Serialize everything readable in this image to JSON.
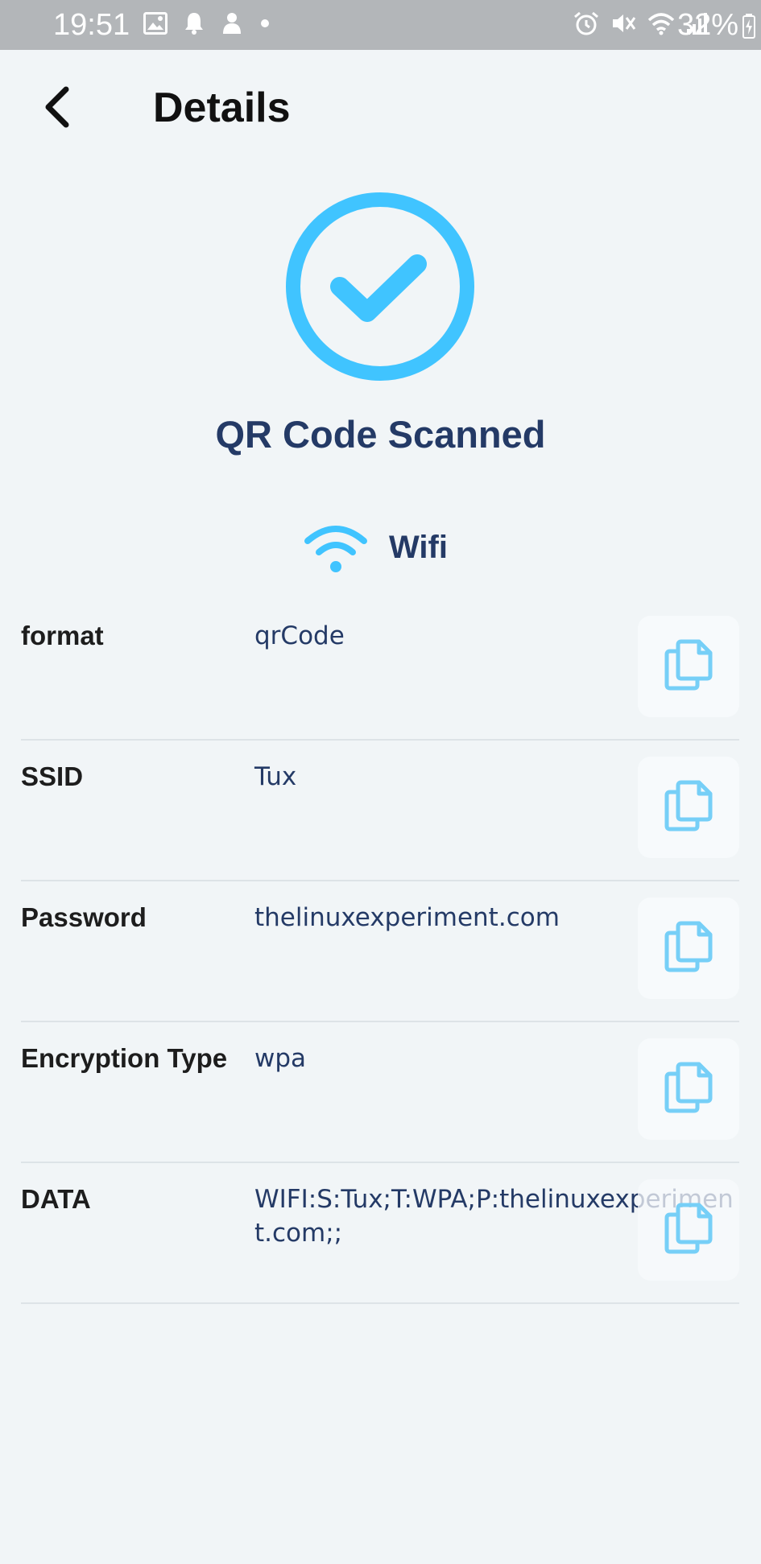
{
  "status_bar": {
    "time": "19:51",
    "battery_percent": "32%",
    "left_icons": [
      "image-icon",
      "bell-icon",
      "app-notification-icon",
      "dot-icon"
    ],
    "right_icons": [
      "alarm-icon",
      "mute-icon",
      "wifi-status-icon",
      "signal-icon",
      "battery-icon"
    ]
  },
  "header": {
    "title": "Details",
    "back_icon": "chevron-left-icon"
  },
  "result": {
    "title": "QR Code Scanned",
    "icon": "check-circle-icon",
    "type_label": "Wifi",
    "type_icon": "wifi-icon"
  },
  "details": [
    {
      "label": "format",
      "value": "qrCode"
    },
    {
      "label": "SSID",
      "value": "Tux"
    },
    {
      "label": "Password",
      "value": "thelinuxexperiment.com"
    },
    {
      "label": "Encryption Type",
      "value": "wpa"
    },
    {
      "label": "DATA",
      "value": "WIFI:S:Tux;T:WPA;P:thelinuxexperiment.com;;"
    }
  ],
  "colors": {
    "accent": "#40c4ff",
    "title_text": "#243a66",
    "background": "#f1f5f7",
    "status_bar": "#b3b6b9",
    "copy_icon": "#76cff7"
  }
}
